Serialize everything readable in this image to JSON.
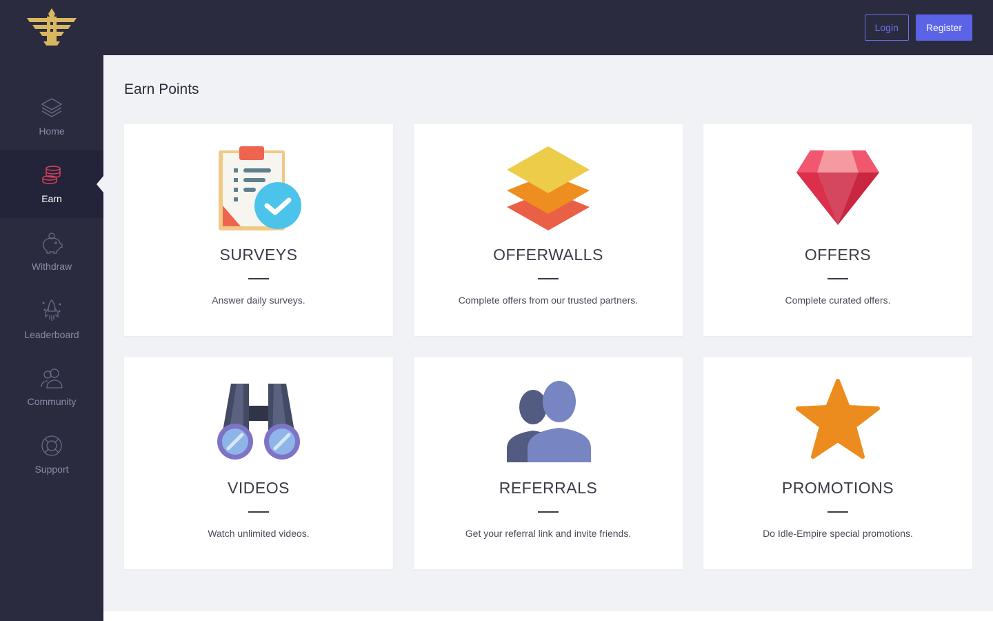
{
  "brand": {
    "logo_icon": "eagle-logo-icon",
    "accent": "#d9b760"
  },
  "topbar": {
    "login_label": "Login",
    "register_label": "Register"
  },
  "sidebar": {
    "items": [
      {
        "label": "Home",
        "icon": "layers-icon",
        "active": false
      },
      {
        "label": "Earn",
        "icon": "coins-icon",
        "active": true
      },
      {
        "label": "Withdraw",
        "icon": "piggy-bank-icon",
        "active": false
      },
      {
        "label": "Leaderboard",
        "icon": "rocket-icon",
        "active": false
      },
      {
        "label": "Community",
        "icon": "users-icon",
        "active": false
      },
      {
        "label": "Support",
        "icon": "lifebuoy-icon",
        "active": false
      }
    ]
  },
  "main": {
    "title": "Earn Points",
    "cards": [
      {
        "title": "SURVEYS",
        "desc": "Answer daily surveys.",
        "icon": "clipboard-check-icon"
      },
      {
        "title": "OFFERWALLS",
        "desc": "Complete offers from our trusted partners.",
        "icon": "stacked-layers-icon"
      },
      {
        "title": "OFFERS",
        "desc": "Complete curated offers.",
        "icon": "ruby-gem-icon"
      },
      {
        "title": "VIDEOS",
        "desc": "Watch unlimited videos.",
        "icon": "binoculars-icon"
      },
      {
        "title": "REFERRALS",
        "desc": "Get your referral link and invite friends.",
        "icon": "people-icon"
      },
      {
        "title": "PROMOTIONS",
        "desc": "Do Idle-Empire special promotions.",
        "icon": "star-icon"
      }
    ]
  },
  "colors": {
    "sidebar_bg": "#2a2b3f",
    "page_bg": "#f1f2f6",
    "primary": "#5b63e6"
  }
}
